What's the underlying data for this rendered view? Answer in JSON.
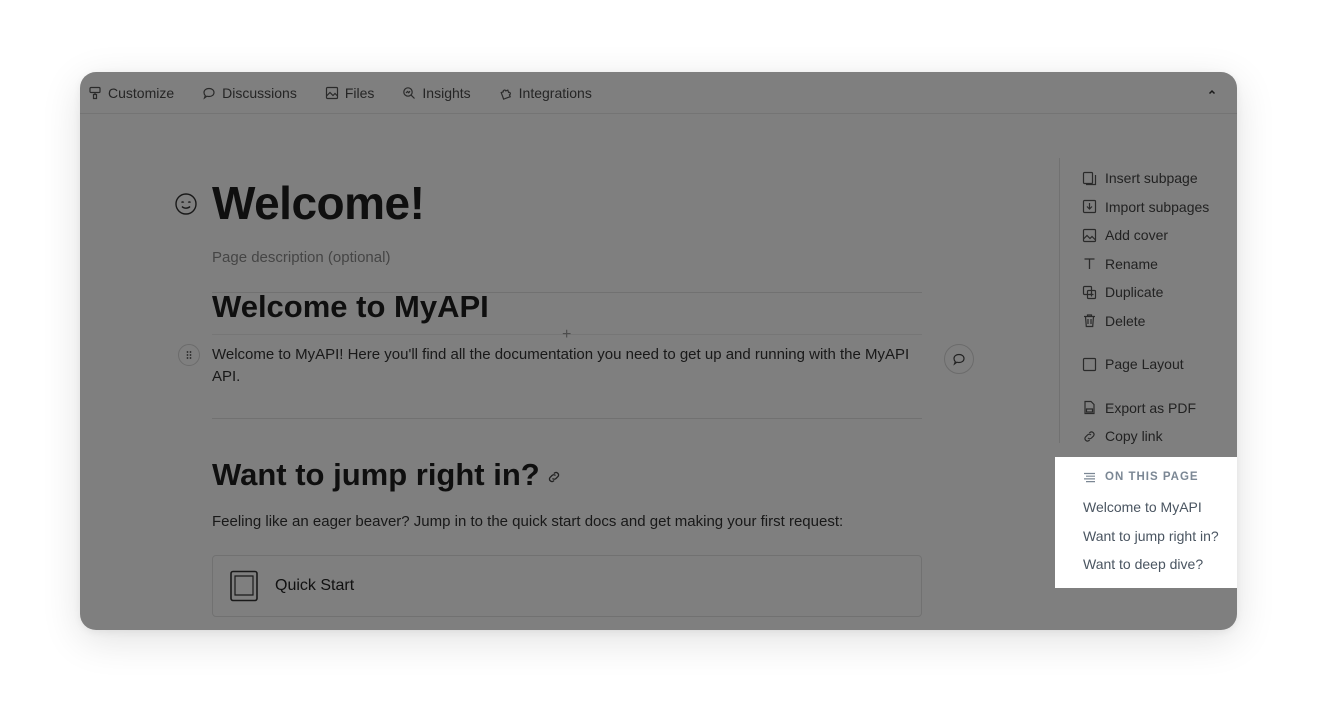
{
  "topbar": {
    "tabs": [
      {
        "label": "Customize",
        "icon": "paint-icon"
      },
      {
        "label": "Discussions",
        "icon": "chat-bubble-icon"
      },
      {
        "label": "Files",
        "icon": "image-file-icon"
      },
      {
        "label": "Insights",
        "icon": "magnifier-chart-icon"
      },
      {
        "label": "Integrations",
        "icon": "puzzle-icon"
      }
    ],
    "collapse_icon": "chevron-up-icon"
  },
  "page": {
    "title": "Welcome!",
    "description_placeholder": "Page description (optional)",
    "sections": [
      {
        "heading": "Welcome to MyAPI",
        "text": "Welcome to MyAPI! Here you'll find all the documentation you need to get up and running with the MyAPI API."
      },
      {
        "heading": "Want to jump right in?",
        "text": "Feeling like an eager beaver? Jump in to the quick start docs and get making your first request:"
      }
    ],
    "card": {
      "label": "Quick Start",
      "icon": "tablet-icon"
    }
  },
  "actions": [
    {
      "label": "Insert subpage",
      "icon": "pages-icon"
    },
    {
      "label": "Import subpages",
      "icon": "import-icon"
    },
    {
      "label": "Add cover",
      "icon": "image-icon"
    },
    {
      "label": "Rename",
      "icon": "text-icon"
    },
    {
      "label": "Duplicate",
      "icon": "duplicate-icon"
    },
    {
      "label": "Delete",
      "icon": "trash-icon"
    },
    {
      "label": "Page Layout",
      "icon": "layout-icon"
    },
    {
      "label": "Export as PDF",
      "icon": "pdf-icon"
    },
    {
      "label": "Copy link",
      "icon": "link-icon"
    }
  ],
  "toc": {
    "title": "ON THIS PAGE",
    "items": [
      "Welcome to MyAPI",
      "Want to jump right in?",
      "Want to deep dive?"
    ]
  },
  "colors": {
    "overlay": "rgba(0,0,0,0.5)",
    "toc_text": "#4a5561",
    "toc_header": "#7b8794"
  }
}
